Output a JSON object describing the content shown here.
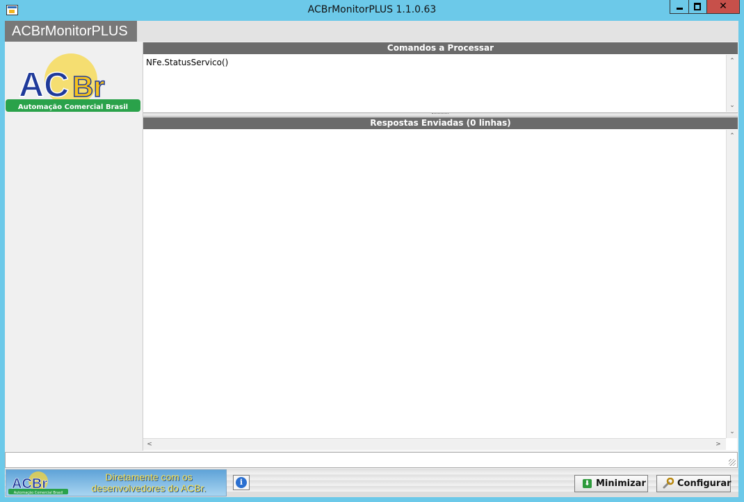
{
  "window": {
    "title": "ACBrMonitorPLUS 1.1.0.63",
    "close_glyph": "✕"
  },
  "header": {
    "app_name": "ACBrMonitorPLUS"
  },
  "logo": {
    "letters_ac": "AC",
    "letters_br": "Br",
    "tagline": "Automação Comercial Brasil"
  },
  "commands": {
    "title": "Comandos a Processar",
    "text": "NFe.StatusServico()"
  },
  "responses": {
    "title": "Respostas Enviadas (0 linhas)",
    "text": ""
  },
  "scroll": {
    "up": "⌃",
    "down": "⌄",
    "left": "<",
    "right": ">"
  },
  "banner": {
    "logo_text": "ACBr",
    "logo_tagline": "Automação Comercial Brasil",
    "line1": "Diretamente com os",
    "line2": "desenvolvedores do ACBr."
  },
  "buttons": {
    "info_glyph": "i",
    "minimize_label": "Minimizar",
    "configure_label": "Configurar"
  },
  "icons": {
    "minimize": "arrow-down-icon",
    "configure": "wrench-icon",
    "info": "info-icon"
  },
  "colors": {
    "titlebar": "#6cc9e9",
    "section_header": "#6b6b6b",
    "banner_text": "#ffe34a",
    "logo_blue": "#1f3a9a",
    "logo_yellow": "#f6c21b",
    "logo_green": "#2aa24a"
  }
}
